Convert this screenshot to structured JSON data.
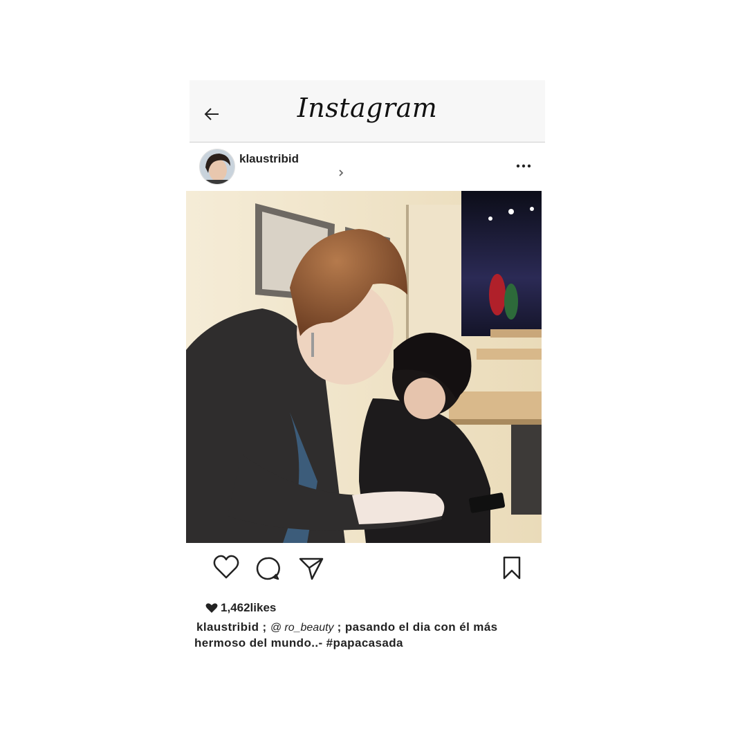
{
  "app": {
    "logo_text": "Instagram"
  },
  "post": {
    "username": "klaustribid",
    "likes_count": "1,462",
    "likes_suffix": "likes",
    "caption": {
      "user": "klaustribid",
      "sep1": " ; ",
      "mention": "@ ro_beauty",
      "text": " ; pasando el dia con él más hermoso del mundo..- #papacasada"
    }
  },
  "icons": {
    "back": "arrow-left-icon",
    "more": "more-horizontal-icon",
    "like": "heart-icon",
    "comment": "comment-icon",
    "share": "send-icon",
    "save": "bookmark-icon"
  },
  "colors": {
    "topbar_bg": "#f7f7f7",
    "text": "#222222",
    "wall": "#f3ead6",
    "hair": "#8a5530"
  }
}
